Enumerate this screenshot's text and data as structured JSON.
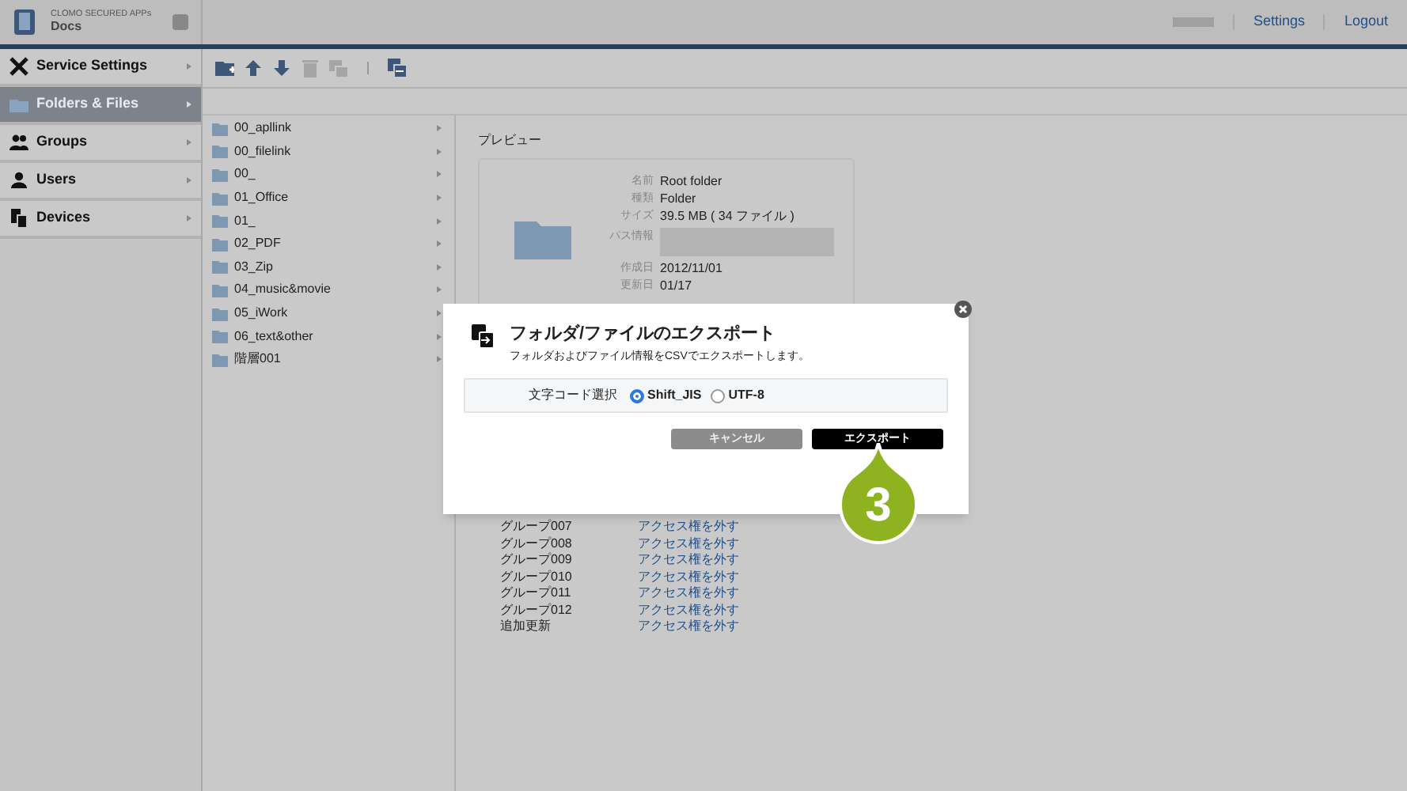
{
  "header": {
    "brand": "CLOMO SECURED APPs",
    "app": "Docs",
    "links": [
      "Settings",
      "Logout"
    ]
  },
  "sidebar": {
    "items": [
      {
        "label": "Service Settings",
        "kind": "tools",
        "selected": false
      },
      {
        "label": "Folders & Files",
        "kind": "folder",
        "selected": true
      },
      {
        "label": "Groups",
        "kind": "groups",
        "selected": false
      },
      {
        "label": "Users",
        "kind": "user",
        "selected": false
      },
      {
        "label": "Devices",
        "kind": "devices",
        "selected": false
      }
    ]
  },
  "toolbar": {
    "tools": [
      {
        "kind": "new-folder",
        "disabled": false
      },
      {
        "kind": "up",
        "disabled": false
      },
      {
        "kind": "down",
        "disabled": false
      },
      {
        "kind": "trash",
        "disabled": true
      },
      {
        "kind": "copy",
        "disabled": true
      },
      {
        "kind": "sep"
      },
      {
        "kind": "export",
        "disabled": false
      }
    ]
  },
  "folders": [
    "00_apllink",
    "00_filelink",
    "00_",
    "01_Office",
    "01_",
    "02_PDF",
    "03_Zip",
    "04_music&movie",
    "05_iWork",
    "06_text&other",
    "階層001"
  ],
  "preview": {
    "title": "プレビュー",
    "fields": [
      {
        "label": "名前",
        "value": "Root folder"
      },
      {
        "label": "種類",
        "value": "Folder"
      },
      {
        "label": "サイズ",
        "value": "39.5 MB ( 34 ファイル )"
      },
      {
        "label": "パス情報",
        "kind": "redacted"
      },
      {
        "label": "作成日",
        "value": "2012/11/01"
      },
      {
        "label": "更新日",
        "value": "01/17"
      }
    ],
    "groups": [
      {
        "name": "グループ007",
        "action": "アクセス権を外す"
      },
      {
        "name": "グループ008",
        "action": "アクセス権を外す"
      },
      {
        "name": "グループ009",
        "action": "アクセス権を外す"
      },
      {
        "name": "グループ010",
        "action": "アクセス権を外す"
      },
      {
        "name": "グループ011",
        "action": "アクセス権を外す"
      },
      {
        "name": "グループ012",
        "action": "アクセス権を外す"
      },
      {
        "name": "追加更新",
        "action": "アクセス権を外す"
      }
    ]
  },
  "dialog": {
    "title": "フォルダ/ファイルのエクスポート",
    "description": "フォルダおよびファイル情報をCSVでエクスポートします。",
    "encoding_label": "文字コード選択",
    "options": [
      {
        "label": "Shift_JIS",
        "selected": true
      },
      {
        "label": "UTF-8",
        "selected": false
      }
    ],
    "buttons": [
      {
        "label": "キャンセル",
        "kind": "cancel"
      },
      {
        "label": "エクスポート",
        "kind": "primary"
      }
    ]
  },
  "callout": {
    "number": "3"
  }
}
